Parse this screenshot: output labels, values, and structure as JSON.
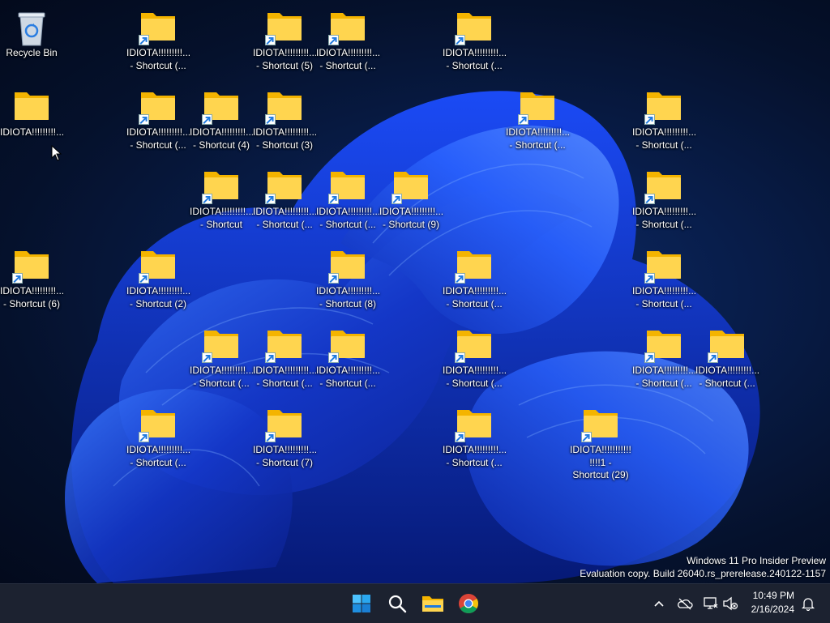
{
  "desktop": {
    "recycle_bin": {
      "label": "Recycle Bin"
    },
    "icons": [
      {
        "label": "IDIOTA!!!!!!!!!...\n- Shortcut (...",
        "shortcut": true
      },
      {
        "label": "IDIOTA!!!!!!!!!...\n- Shortcut (5)",
        "shortcut": true
      },
      {
        "label": "IDIOTA!!!!!!!!!...\n- Shortcut (...",
        "shortcut": true
      },
      {
        "label": "IDIOTA!!!!!!!!!...\n- Shortcut (...",
        "shortcut": true
      },
      {
        "label": "IDIOTA!!!!!!!!!...",
        "shortcut": false
      },
      {
        "label": "IDIOTA!!!!!!!!!...\n- Shortcut (...",
        "shortcut": true
      },
      {
        "label": "IDIOTA!!!!!!!!!...\n- Shortcut (4)",
        "shortcut": true
      },
      {
        "label": "IDIOTA!!!!!!!!!...\n- Shortcut (3)",
        "shortcut": true
      },
      {
        "label": "IDIOTA!!!!!!!!!...\n- Shortcut (...",
        "shortcut": true
      },
      {
        "label": "IDIOTA!!!!!!!!!...\n- Shortcut (...",
        "shortcut": true
      },
      {
        "label": "IDIOTA!!!!!!!!!...\n- Shortcut",
        "shortcut": true
      },
      {
        "label": "IDIOTA!!!!!!!!!...\n- Shortcut (...",
        "shortcut": true
      },
      {
        "label": "IDIOTA!!!!!!!!!...\n- Shortcut (...",
        "shortcut": true
      },
      {
        "label": "IDIOTA!!!!!!!!!...\n- Shortcut (9)",
        "shortcut": true
      },
      {
        "label": "IDIOTA!!!!!!!!!...\n- Shortcut (...",
        "shortcut": true
      },
      {
        "label": "IDIOTA!!!!!!!!!...\n- Shortcut (6)",
        "shortcut": true
      },
      {
        "label": "IDIOTA!!!!!!!!!...\n- Shortcut (2)",
        "shortcut": true
      },
      {
        "label": "IDIOTA!!!!!!!!!...\n- Shortcut (8)",
        "shortcut": true
      },
      {
        "label": "IDIOTA!!!!!!!!!...\n- Shortcut (...",
        "shortcut": true
      },
      {
        "label": "IDIOTA!!!!!!!!!...\n- Shortcut (...",
        "shortcut": true
      },
      {
        "label": "IDIOTA!!!!!!!!!...\n- Shortcut (...",
        "shortcut": true
      },
      {
        "label": "IDIOTA!!!!!!!!!...\n- Shortcut (...",
        "shortcut": true
      },
      {
        "label": "IDIOTA!!!!!!!!!...\n- Shortcut (...",
        "shortcut": true
      },
      {
        "label": "IDIOTA!!!!!!!!!...\n- Shortcut (...",
        "shortcut": true
      },
      {
        "label": "IDIOTA!!!!!!!!!...\n- Shortcut (...",
        "shortcut": true
      },
      {
        "label": "IDIOTA!!!!!!!!!...\n- Shortcut (...",
        "shortcut": true
      },
      {
        "label": "IDIOTA!!!!!!!!!...\n- Shortcut (...",
        "shortcut": true
      },
      {
        "label": "IDIOTA!!!!!!!!!...\n- Shortcut (7)",
        "shortcut": true
      },
      {
        "label": "IDIOTA!!!!!!!!!...\n- Shortcut (...",
        "shortcut": true
      },
      {
        "label": "IDIOTA!!!!!!!!!!!\n!!!!1 -\nShortcut (29)",
        "shortcut": true
      }
    ]
  },
  "watermark": {
    "line1": "Windows 11 Pro Insider Preview",
    "line2": "Evaluation copy. Build 26040.rs_prerelease.240122-1157"
  },
  "taskbar": {
    "apps": [
      {
        "name": "start-button",
        "icon": "windows-logo-icon"
      },
      {
        "name": "search-button",
        "icon": "search-icon"
      },
      {
        "name": "file-explorer-button",
        "icon": "folder-icon"
      },
      {
        "name": "chrome-button",
        "icon": "chrome-icon"
      }
    ],
    "tray": [
      "chevron-up-icon",
      "onedrive-offline-icon",
      "network-icon",
      "volume-muted-icon"
    ],
    "clock": {
      "time": "10:49 PM",
      "date": "2/16/2024"
    }
  },
  "colors": {
    "folder_front": "#ffd54f",
    "folder_back": "#f4b400",
    "accent": "#1f7ae0",
    "taskbar_bg": "#1c2230"
  }
}
